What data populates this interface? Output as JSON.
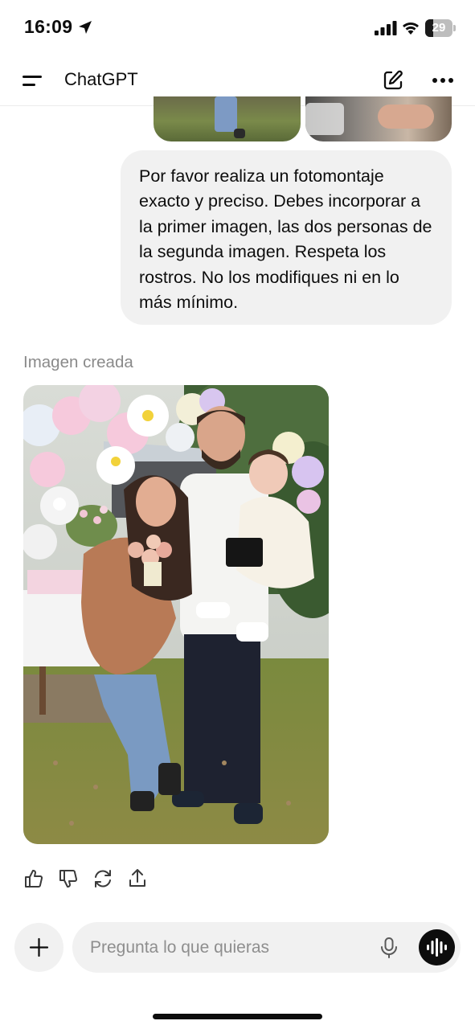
{
  "status_bar": {
    "time": "16:09",
    "battery_level": "29",
    "battery_fraction": 0.29
  },
  "header": {
    "title": "ChatGPT",
    "icons": [
      "menu-icon",
      "new-chat-icon",
      "more-icon"
    ]
  },
  "conversation": {
    "user_message": "Por favor realiza un fotomontaje exacto y preciso. Debes incorporar a la primer imagen, las dos personas de la segunda imagen. Respeta los rostros. No los modifiques ni en lo más mínimo.",
    "assistant_label": "Imagen creada",
    "action_icons": [
      "thumbs-up-icon",
      "thumbs-down-icon",
      "regenerate-icon",
      "share-icon"
    ]
  },
  "composer": {
    "placeholder": "Pregunta lo que quieras",
    "value": ""
  },
  "colors": {
    "bubble_bg": "#f1f1f1",
    "muted_text": "#8a8a8a",
    "accent": "#0d0d0d"
  }
}
